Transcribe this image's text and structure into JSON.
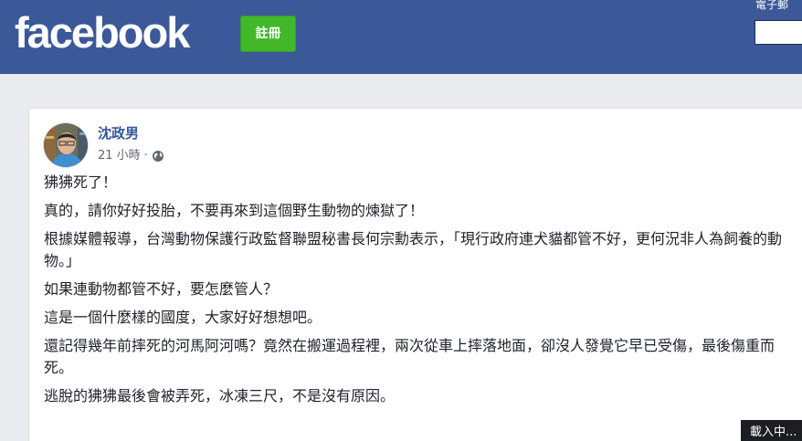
{
  "header": {
    "logo_text": "facebook",
    "signup_label": "註冊",
    "email_label": "電子郵",
    "brand_color": "#3b5998",
    "signup_color": "#42b72a"
  },
  "post": {
    "author": "沈政男",
    "time": "21 小時",
    "separator": "·",
    "privacy_icon": "globe-icon",
    "paragraphs": [
      "狒狒死了！",
      "真的，請你好好投胎，不要再來到這個野生動物的煉獄了！",
      "根據媒體報導，台灣動物保護行政監督聯盟秘書長何宗勳表示，「現行政府連犬貓都管不好，更何況非人為飼養的動物。」",
      "如果連動物都管不好，要怎麼管人？",
      "這是一個什麼樣的國度，大家好好想想吧。",
      "還記得幾年前摔死的河馬阿河嗎？竟然在搬運過程裡，兩次從車上摔落地面，卻沒人發覺它早已受傷，最後傷重而死。",
      "逃脫的狒狒最後會被弄死，冰凍三尺，不是沒有原因。"
    ]
  },
  "status": {
    "loading_text": "載入中..."
  }
}
